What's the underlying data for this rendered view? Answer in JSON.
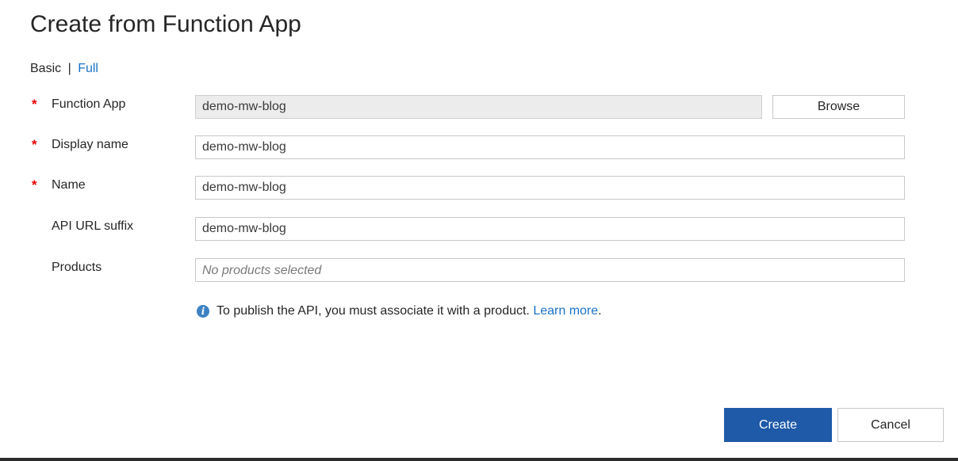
{
  "dialog": {
    "title": "Create from Function App"
  },
  "mode": {
    "basic_label": "Basic",
    "separator": "|",
    "full_label": "Full"
  },
  "form": {
    "function_app": {
      "label": "Function App",
      "required": "*",
      "value": "demo-mw-blog",
      "browse_label": "Browse"
    },
    "display_name": {
      "label": "Display name",
      "required": "*",
      "value": "demo-mw-blog"
    },
    "name": {
      "label": "Name",
      "required": "*",
      "value": "demo-mw-blog"
    },
    "api_url_suffix": {
      "label": "API URL suffix",
      "value": "demo-mw-blog"
    },
    "products": {
      "label": "Products",
      "placeholder": "No products selected"
    }
  },
  "info": {
    "icon": "info-icon",
    "text": "To publish the API, you must associate it with a product.",
    "link": "Learn more",
    "end": "."
  },
  "footer": {
    "create_label": "Create",
    "cancel_label": "Cancel"
  },
  "colors": {
    "accent": "#1e5aa8",
    "link": "#1a73c8",
    "required": "#e50000"
  }
}
